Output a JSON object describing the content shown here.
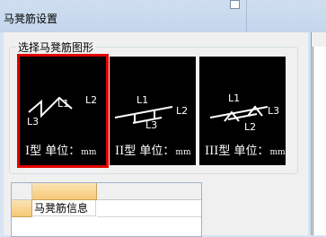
{
  "window": {
    "title": "马凳筋设置"
  },
  "group": {
    "label": "选择马凳筋图形"
  },
  "tiles": [
    {
      "caption": "I型 单位：",
      "unit": "mm",
      "labels": [
        "L1",
        "L2",
        "L3"
      ]
    },
    {
      "caption": "II型 单位：",
      "unit": "mm",
      "labels": [
        "L1",
        "L2",
        "L3"
      ]
    },
    {
      "caption": "III型 单位：",
      "unit": "mm",
      "labels": [
        "L1",
        "L2",
        "L3"
      ]
    }
  ],
  "grid": {
    "rows": [
      {
        "name": "马凳筋信息",
        "value": ""
      }
    ]
  },
  "colors": {
    "selected_border": "#e00000",
    "header_fill": "#f6c877"
  }
}
